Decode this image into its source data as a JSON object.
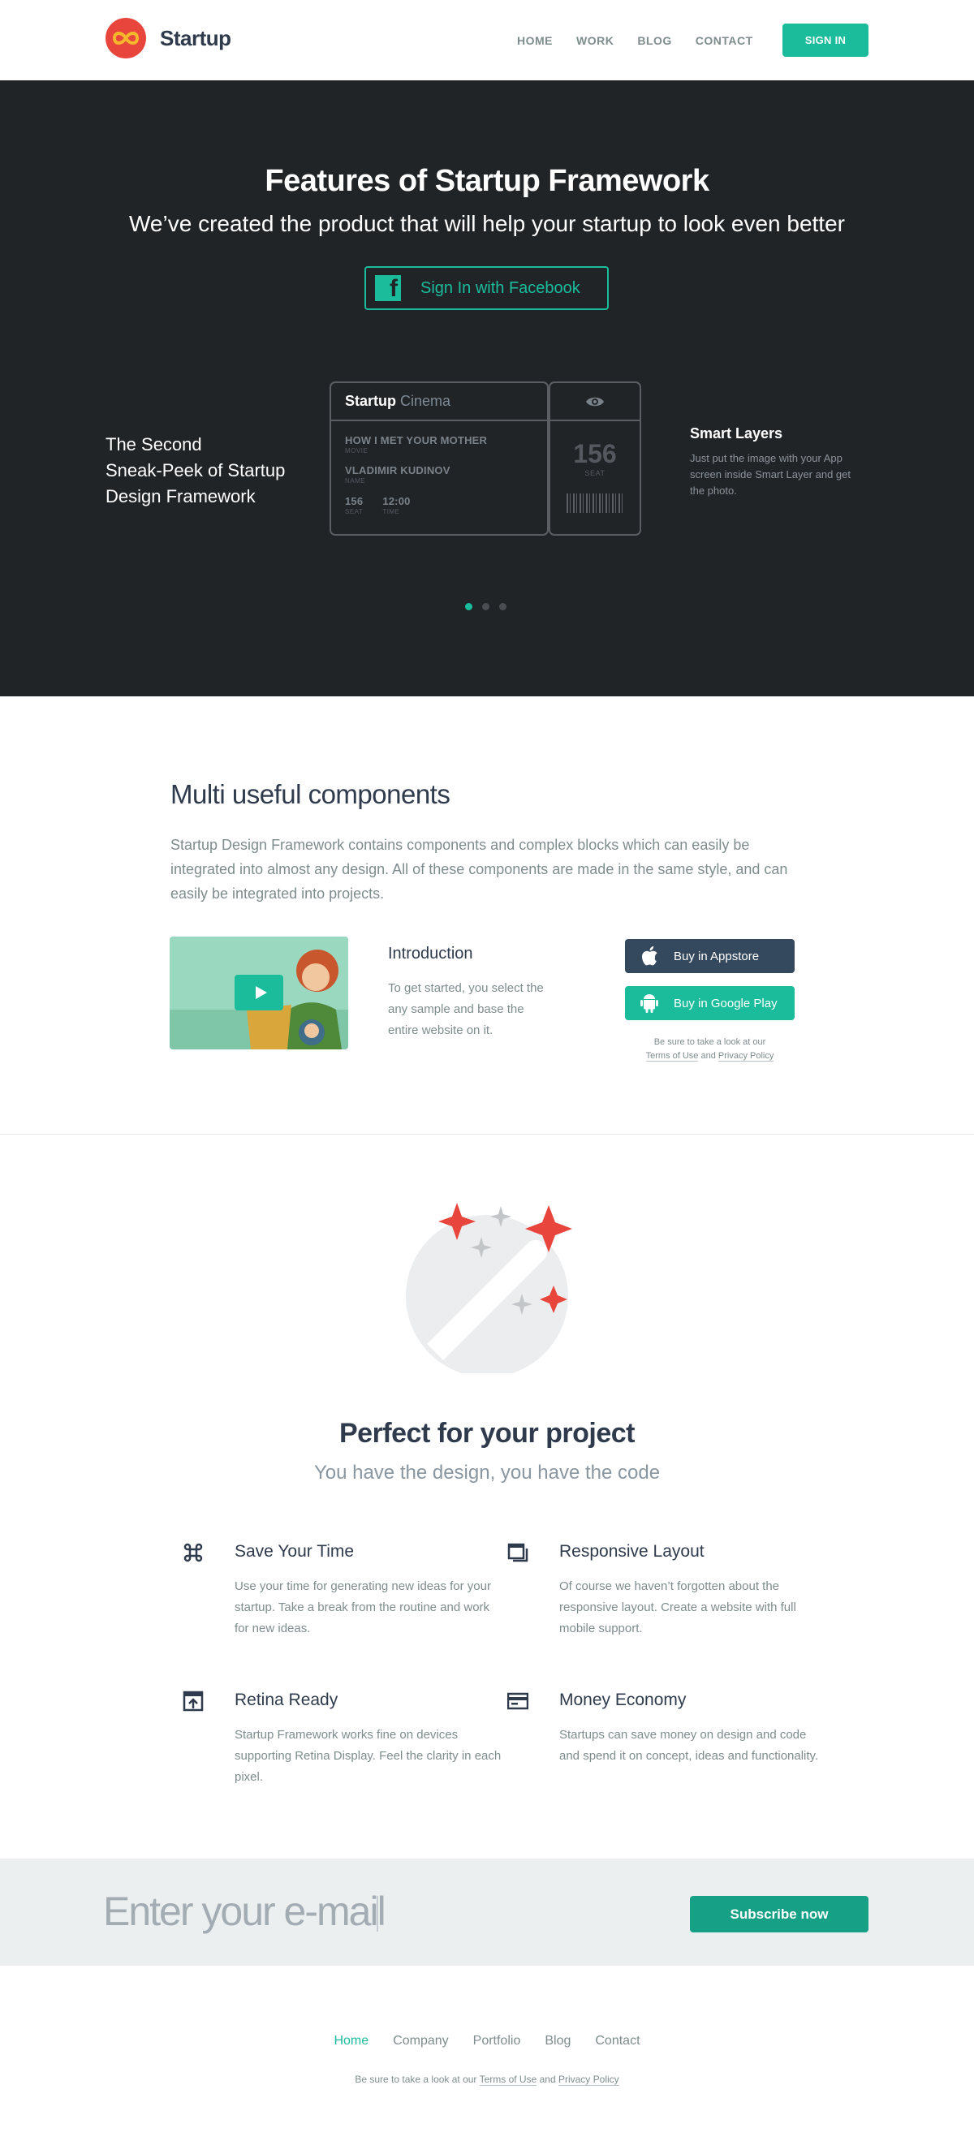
{
  "header": {
    "logo_text": "Startup",
    "nav": [
      "HOME",
      "WORK",
      "BLOG",
      "CONTACT"
    ],
    "signin": "SIGN IN"
  },
  "hero": {
    "title": "Features of Startup Framework",
    "subtitle": "We’ve created the product that will help your startup to look even better",
    "facebook_button": "Sign In with Facebook",
    "left_line1": "The Second",
    "left_line2": "Sneak-Peek of Startup",
    "left_line3": "Design Framework",
    "ticket": {
      "brand": "Startup",
      "brand_sub": "Cinema",
      "movie": "HOW I MET YOUR MOTHER",
      "movie_cap": "MOVIE",
      "name": "VLADIMIR KUDINOV",
      "name_cap": "NAME",
      "seat": "156",
      "seat_cap": "SEAT",
      "time": "12:00",
      "time_cap": "TIME",
      "stub_seat": "156",
      "stub_seat_cap": "SEAT"
    },
    "right_title": "Smart Layers",
    "right_text": "Just put the image with your App screen inside Smart Layer and get the photo.",
    "slide_count": 3,
    "active_slide": 1
  },
  "components": {
    "title": "Multi useful components",
    "description": "Startup Design Framework contains components and complex blocks which can easily be integrated into almost any design. All of these components are made in the same style, and can easily be integrated into projects.",
    "intro_title": "Introduction",
    "intro_text": "To get started, you select the any sample and base the entire website on it.",
    "appstore": "Buy in Appstore",
    "googleplay": "Buy in Google Play",
    "terms_pre": "Be sure to take a look at our",
    "terms_link": "Terms of Use",
    "terms_and": "and",
    "privacy_link": "Privacy Policy"
  },
  "perfect": {
    "title": "Perfect for your project",
    "subtitle": "You have the design, you have the code",
    "features": [
      {
        "icon": "command-icon",
        "title": "Save Your Time",
        "text": "Use your time for generating new ideas for your startup. Take a break from the routine and work for new ideas."
      },
      {
        "icon": "windows-icon",
        "title": "Responsive Layout",
        "text": "Of course we haven’t forgotten about the responsive layout. Create a website with full mobile support."
      },
      {
        "icon": "retina-icon",
        "title": "Retina Ready",
        "text": "Startup Framework works fine on devices supporting Retina Display. Feel the clarity in each pixel."
      },
      {
        "icon": "card-icon",
        "title": "Money Economy",
        "text": "Startups can save money on design and code and spend it on concept, ideas and functionality."
      }
    ]
  },
  "subscribe": {
    "placeholder": "Enter your e-mail",
    "button": "Subscribe now"
  },
  "footer": {
    "nav": [
      "Home",
      "Company",
      "Portfolio",
      "Blog",
      "Contact"
    ],
    "terms_pre": "Be sure to take a look at our",
    "terms_link": "Terms of Use",
    "terms_and": "and",
    "privacy_link": "Privacy Policy"
  },
  "colors": {
    "accent": "#1abc9c",
    "dark": "#212427",
    "navy": "#34495e",
    "red": "#e8453c"
  }
}
